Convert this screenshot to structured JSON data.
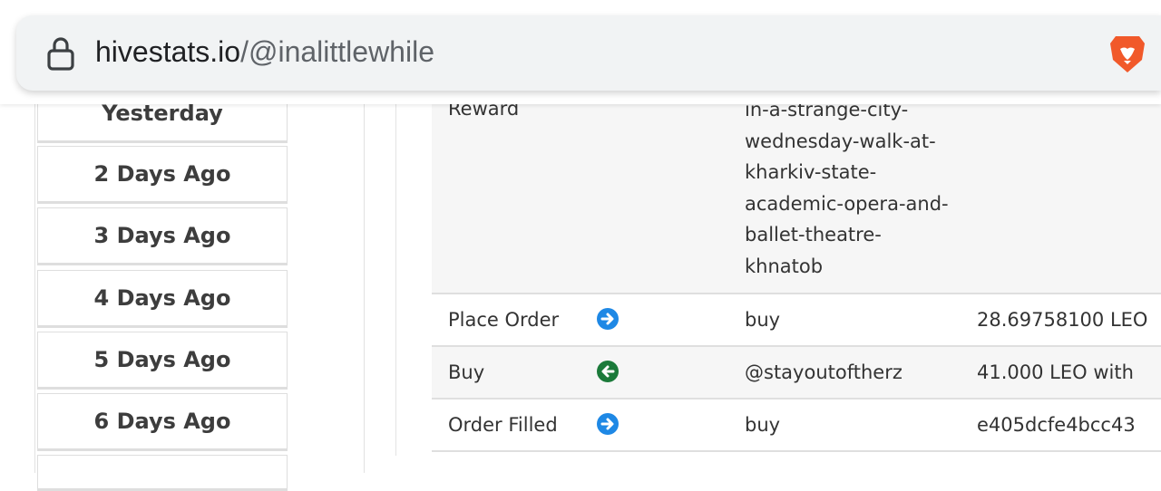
{
  "browser": {
    "url_host": "hivestats.io",
    "url_path": "/@inalittlewhile",
    "brand_icon": "brave-lion-icon",
    "lock_icon": "lock-icon"
  },
  "sidebar": {
    "items": [
      {
        "label": "Yesterday"
      },
      {
        "label": "2 Days Ago"
      },
      {
        "label": "3 Days Ago"
      },
      {
        "label": "4 Days Ago"
      },
      {
        "label": "5 Days Ago"
      },
      {
        "label": "6 Days Ago"
      }
    ]
  },
  "table": {
    "rows": [
      {
        "type": "Reward",
        "detail_lines": [
          "in-a-strange-city-",
          "wednesday-walk-at-",
          "kharkiv-state-",
          "academic-opera-and-",
          "ballet-theatre-",
          "khnatob"
        ],
        "amount": ""
      },
      {
        "type": "Place Order",
        "direction": "right",
        "icon_color": "#1e88e5",
        "detail": "buy",
        "amount": "28.69758100 LEO"
      },
      {
        "type": "Buy",
        "direction": "left",
        "icon_color": "#1b7a3a",
        "detail": "@stayoutoftherz",
        "amount": "41.000 LEO with"
      },
      {
        "type": "Order Filled",
        "direction": "right",
        "icon_color": "#1e88e5",
        "detail": "buy",
        "amount": "e405dcfe4bcc43"
      }
    ]
  }
}
